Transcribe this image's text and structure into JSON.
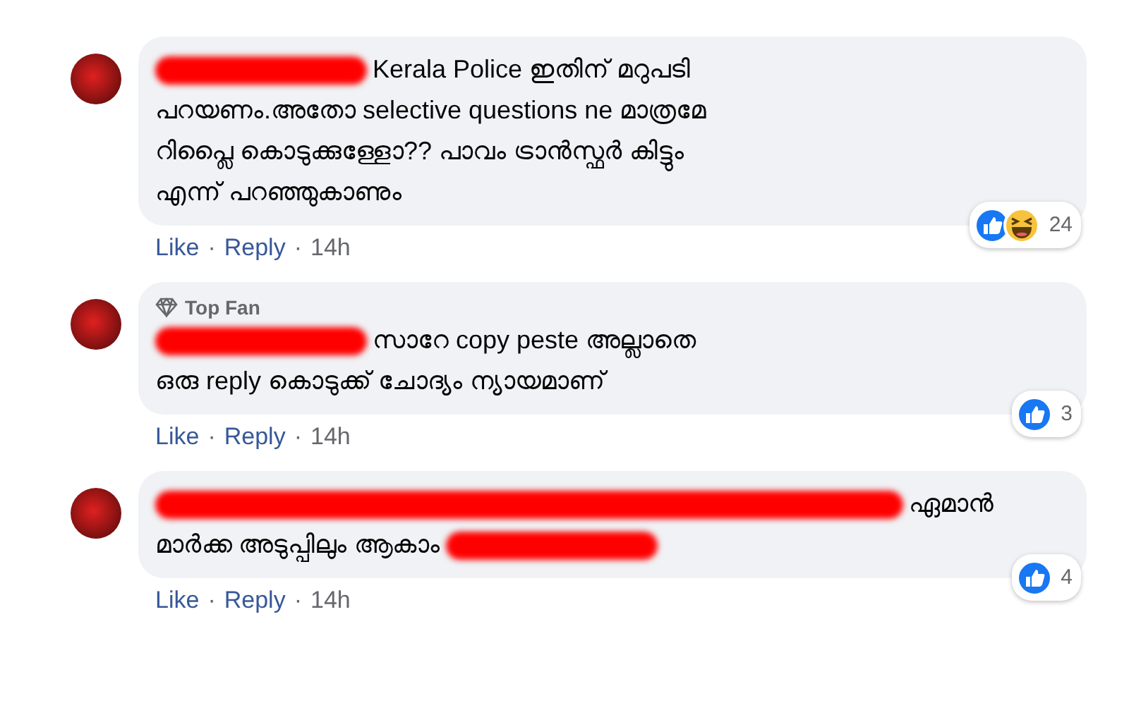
{
  "comments": [
    {
      "lines": [
        [
          {
            "kind": "redaction",
            "wide": false
          },
          {
            "kind": "text",
            "text": "Kerala Police ഇതിന് മറുപടി"
          }
        ],
        [
          {
            "kind": "text",
            "text": "പറയണം.അതോ selective questions ne മാത്രമേ"
          }
        ],
        [
          {
            "kind": "text",
            "text": "റിപ്ലൈ കൊടുക്കുള്ളോ?? പാവം ട്രാൻസ്ഫർ കിട്ടും"
          }
        ],
        [
          {
            "kind": "text",
            "text": "എന്ന് പറഞ്ഞുകാണും"
          }
        ]
      ],
      "actions": [
        {
          "text": "Like",
          "kind": "link"
        },
        {
          "text": "·",
          "kind": "separator"
        },
        {
          "text": "Reply",
          "kind": "link"
        },
        {
          "text": "·",
          "kind": "separator"
        },
        {
          "text": "14h",
          "kind": "time"
        }
      ],
      "reactions": [
        {
          "kind": "like"
        },
        {
          "kind": "haha"
        }
      ],
      "reaction_count": "24"
    },
    {
      "badge": "Top Fan",
      "lines": [
        [
          {
            "kind": "redaction",
            "wide": false
          },
          {
            "kind": "text",
            "text": "സാറേ copy peste അല്ലാതെ"
          }
        ],
        [
          {
            "kind": "text",
            "text": "ഒരു reply കൊടുക്ക് ചോദ്യം ന്യായമാണ്"
          }
        ]
      ],
      "actions": [
        {
          "text": "Like",
          "kind": "link"
        },
        {
          "text": "·",
          "kind": "separator"
        },
        {
          "text": "Reply",
          "kind": "link"
        },
        {
          "text": "·",
          "kind": "separator"
        },
        {
          "text": "14h",
          "kind": "time"
        }
      ],
      "reactions": [
        {
          "kind": "like"
        }
      ],
      "reaction_count": "3"
    },
    {
      "lines": [
        [
          {
            "kind": "redaction",
            "wide": true
          },
          {
            "kind": "text",
            "text": "ഏമാൻ"
          }
        ],
        [
          {
            "kind": "text",
            "text": "മാർക്ക അടുപ്പിലും ആകാം"
          },
          {
            "kind": "redaction",
            "wide": false
          }
        ]
      ],
      "actions": [
        {
          "text": "Like",
          "kind": "link"
        },
        {
          "text": "·",
          "kind": "separator"
        },
        {
          "text": "Reply",
          "kind": "link"
        },
        {
          "text": "·",
          "kind": "separator"
        },
        {
          "text": "14h",
          "kind": "time"
        }
      ],
      "reactions": [
        {
          "kind": "like"
        }
      ],
      "reaction_count": "4"
    }
  ]
}
